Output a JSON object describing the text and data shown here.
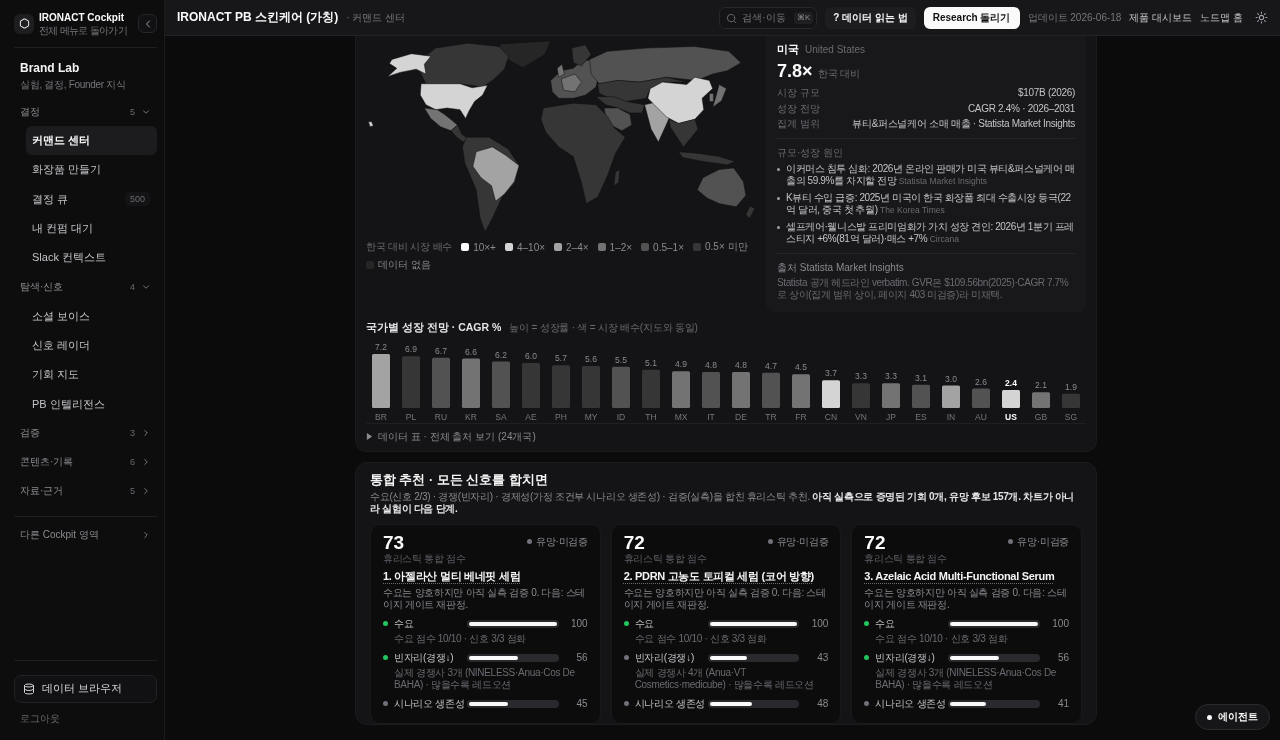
{
  "sidebar": {
    "app": {
      "title": "IRONACT Cockpit",
      "subtitle": "전체 메뉴로 돌아가기"
    },
    "section": {
      "title": "Brand Lab",
      "subtitle": "실험, 결정, Founder 지식"
    },
    "groups": [
      {
        "label": "결정",
        "count": "5",
        "expanded": true,
        "items": [
          {
            "label": "커맨드 센터",
            "selected": true
          },
          {
            "label": "화장품 만들기",
            "selected": false
          },
          {
            "label": "결정 큐",
            "count": "500",
            "selected": false
          },
          {
            "label": "내 컨펌 대기",
            "selected": false
          },
          {
            "label": "Slack 컨텍스트",
            "selected": false
          }
        ]
      },
      {
        "label": "탐색·신호",
        "count": "4",
        "expanded": true,
        "items": [
          {
            "label": "소셜 보이스",
            "selected": false
          },
          {
            "label": "신호 레이더",
            "selected": false
          },
          {
            "label": "기회 지도",
            "selected": false
          },
          {
            "label": "PB 인텔리전스",
            "selected": false
          }
        ]
      },
      {
        "label": "검증",
        "count": "3",
        "expanded": false
      },
      {
        "label": "콘텐츠·기록",
        "count": "6",
        "expanded": false
      },
      {
        "label": "자료·근거",
        "count": "5",
        "expanded": false
      }
    ],
    "other_link": "다른 Cockpit 영역",
    "data_browser": "데이터 브라우저",
    "logout": "로그아웃"
  },
  "header": {
    "title": "IRONACT PB 스킨케어 (가칭)",
    "breadcrumb": "· 커맨드 센터",
    "search": {
      "placeholder": "검색·이동",
      "shortcut": "⌘K"
    },
    "help_button": "? 데이터 읽는 법",
    "primary_button": "Research 돌리기",
    "updated": "업데이트 2026-06-18",
    "links": [
      "제품 대시보드",
      "노드맵 홈"
    ]
  },
  "map": {
    "legend": {
      "title": "한국 대비 시장 배수",
      "items": [
        {
          "label": "10×+",
          "color": "#fafafa"
        },
        {
          "label": "4–10×",
          "color": "#d4d4d4"
        },
        {
          "label": "2–4×",
          "color": "#a3a3a3"
        },
        {
          "label": "1–2×",
          "color": "#737373"
        },
        {
          "label": "0.5–1×",
          "color": "#525252"
        },
        {
          "label": "0.5× 미만",
          "color": "#363636"
        },
        {
          "label": "데이터 없음",
          "color": "#262626"
        }
      ]
    }
  },
  "country_panel": {
    "name": "미국",
    "name_en": "United States",
    "multiple": "7.8×",
    "multiple_note": "한국 대비",
    "facts": [
      {
        "label": "시장 규모",
        "value": "$107B (2026)"
      },
      {
        "label": "성장 전망",
        "value": "CAGR 2.4% · 2026–2031"
      },
      {
        "label": "집계 범위",
        "value": "뷰티&퍼스널케어 소매 매출 · Statista Market Insights"
      }
    ],
    "drivers_title": "규모·성장 원인",
    "drivers": [
      {
        "text": "이커머스 침투 심화: 2026년 온라인 판매가 미국 뷰티&퍼스널케어 매출의 59.9%를 차지할 전망",
        "source": "Statista Market Insights"
      },
      {
        "text": "K뷰티 수입 급증: 2025년 미국이 한국 화장품 최대 수출시장 등극(22억 달러, 중국 첫 추월)",
        "source": "The Korea Times"
      },
      {
        "text": "셀프케어·웰니스발 프리미엄화가 가치 성장 견인: 2026년 1분기 프레스티지 +6%(81억 달러)·매스 +7%",
        "source": "Circana"
      }
    ],
    "source_label": "출처 Statista Market Insights",
    "note": "Statista 공개 헤드라인 verbatim. GVR은 $109.56bn(2025)·CAGR 7.7%로 상이(집계 범위 상이, 페이지 403 미검증)라 미채택."
  },
  "growth_chart": {
    "title": "국가별 성장 전망 · CAGR %",
    "subtitle": "높이 = 성장률 · 색 = 시장 배수(지도와 동일)",
    "bars": [
      {
        "color": "#a3a3a3",
        "selected": false
      },
      {
        "color": "#363636",
        "selected": false
      },
      {
        "color": "#525252",
        "selected": false
      },
      {
        "color": "#737373",
        "selected": false
      },
      {
        "color": "#525252",
        "selected": false
      },
      {
        "color": "#363636",
        "selected": false
      },
      {
        "color": "#363636",
        "selected": false
      },
      {
        "color": "#363636",
        "selected": false
      },
      {
        "color": "#525252",
        "selected": false
      },
      {
        "color": "#363636",
        "selected": false
      },
      {
        "color": "#737373",
        "selected": false
      },
      {
        "color": "#525252",
        "selected": false
      },
      {
        "color": "#737373",
        "selected": false
      },
      {
        "color": "#525252",
        "selected": false
      },
      {
        "color": "#737373",
        "selected": false
      },
      {
        "color": "#d4d4d4",
        "selected": false
      },
      {
        "color": "#363636",
        "selected": false
      },
      {
        "color": "#737373",
        "selected": false
      },
      {
        "color": "#525252",
        "selected": false
      },
      {
        "color": "#a3a3a3",
        "selected": false
      },
      {
        "color": "#525252",
        "selected": false
      },
      {
        "color": "#d4d4d4",
        "selected": true
      },
      {
        "color": "#737373",
        "selected": false
      },
      {
        "color": "#363636",
        "selected": false
      }
    ],
    "chart_data": {
      "type": "bar",
      "categories": [
        "BR",
        "PL",
        "RU",
        "KR",
        "SA",
        "AE",
        "PH",
        "MY",
        "ID",
        "TH",
        "MX",
        "IT",
        "DE",
        "TR",
        "FR",
        "CN",
        "VN",
        "JP",
        "ES",
        "IN",
        "AU",
        "US",
        "GB",
        "SG"
      ],
      "values": [
        7.2,
        6.9,
        6.7,
        6.6,
        6.2,
        6.0,
        5.7,
        5.6,
        5.5,
        5.1,
        4.9,
        4.8,
        4.8,
        4.7,
        4.5,
        3.7,
        3.3,
        3.3,
        3.1,
        3.0,
        2.6,
        2.4,
        2.1,
        1.9
      ],
      "value_labels": [
        "7.2",
        "6.9",
        "6.7",
        "6.6",
        "6.2",
        "6.0",
        "5.7",
        "5.6",
        "5.5",
        "5.1",
        "4.9",
        "4.8",
        "4.8",
        "4.7",
        "4.5",
        "3.7",
        "3.3",
        "3.3",
        "3.1",
        "3.0",
        "2.6",
        "2.4",
        "2.1",
        "1.9"
      ]
    }
  },
  "data_table_toggle": {
    "label": "데이터 표 · 전체 출처 보기 (24개국)",
    "expanded": false
  },
  "recommendations": {
    "title": "통합 추천 · 모든 신호를 합치면",
    "summary": "수요(신호 2/3) · 경쟁(빈자리) · 경제성(가정 조건부 시나리오 생존성) · 검증(실측)을 합친 휴리스틱 추천. **아직 실측으로 증명된 기회 0개, 유망 후보 157개. 차트가 아니라 실험이 다음 단계.**",
    "cards": [
      {
        "score": "73",
        "status": "유망·미검증",
        "score_label": "휴리스틱 통합 점수",
        "title": "1. 아젤라산 멀티 베네핏 세럼",
        "description": "수요는 양호하지만 아직 실측 검증 0. 다음: 스테이지 게이트 재판정.",
        "metrics": [
          {
            "label": "수요",
            "color": "#22c55e",
            "level": 1.0,
            "value": "100",
            "detail": "수요 점수 10/10 · 신호 3/3 점화"
          },
          {
            "label": "빈자리(경쟁↓)",
            "color": "#22c55e",
            "level": 0.56,
            "value": "56",
            "detail": "실제 경쟁사 3개 (NINELESS·Anua·Cos De BAHA) · 많을수록 레드오션"
          },
          {
            "label": "시나리오 생존성",
            "color": "#71717a",
            "level": 0.45,
            "value": "45"
          }
        ]
      },
      {
        "score": "72",
        "status": "유망·미검증",
        "score_label": "휴리스틱 통합 점수",
        "title": "2. PDRN 고농도 토피컬 세럼 (코어 방향)",
        "description": "수요는 양호하지만 아직 실측 검증 0. 다음: 스테이지 게이트 재판정.",
        "metrics": [
          {
            "label": "수요",
            "color": "#22c55e",
            "level": 1.0,
            "value": "100",
            "detail": "수요 점수 10/10 · 신호 3/3 점화"
          },
          {
            "label": "빈자리(경쟁↓)",
            "color": "#71717a",
            "level": 0.43,
            "value": "43",
            "detail": "실제 경쟁사 4개 (Anua·VT Cosmetics·medicube) · 많을수록 레드오션"
          },
          {
            "label": "시나리오 생존성",
            "color": "#71717a",
            "level": 0.48,
            "value": "48"
          }
        ]
      },
      {
        "score": "72",
        "status": "유망·미검증",
        "score_label": "휴리스틱 통합 점수",
        "title": "3. Azelaic Acid Multi-Functional Serum",
        "description": "수요는 양호하지만 아직 실측 검증 0. 다음: 스테이지 게이트 재판정.",
        "metrics": [
          {
            "label": "수요",
            "color": "#22c55e",
            "level": 1.0,
            "value": "100",
            "detail": "수요 점수 10/10 · 신호 3/3 점화"
          },
          {
            "label": "빈자리(경쟁↓)",
            "color": "#22c55e",
            "level": 0.56,
            "value": "56",
            "detail": "실제 경쟁사 3개 (NINELESS·Anua·Cos De BAHA) · 많을수록 레드오션"
          },
          {
            "label": "시나리오 생존성",
            "color": "#71717a",
            "level": 0.41,
            "value": "41"
          }
        ]
      }
    ]
  },
  "agent_button": "에이전트"
}
